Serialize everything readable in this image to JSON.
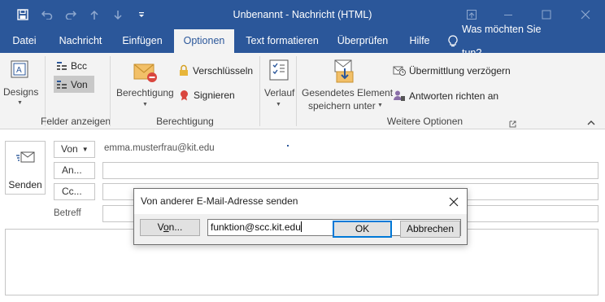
{
  "title_bar": {
    "title": "Unbenannt  -  Nachricht (HTML)",
    "qat_icons": [
      "save-icon",
      "undo-icon",
      "redo-icon",
      "up-arrow-icon",
      "down-arrow-icon",
      "customize-qat-icon"
    ],
    "window_icons": [
      "ribbon-display-options-icon",
      "minimize-icon",
      "maximize-icon",
      "close-icon"
    ]
  },
  "tabs": [
    {
      "label": "Datei"
    },
    {
      "label": "Nachricht"
    },
    {
      "label": "Einfügen"
    },
    {
      "label": "Optionen",
      "active": true
    },
    {
      "label": "Text formatieren"
    },
    {
      "label": "Überprüfen"
    },
    {
      "label": "Hilfe"
    }
  ],
  "tell_me": {
    "label": "Was möchten Sie tun?",
    "icon": "lightbulb-icon"
  },
  "ribbon": {
    "designs": {
      "label": "Designs",
      "icon": "designs-icon"
    },
    "bcc": {
      "label": "Bcc",
      "icon": "bcc-icon"
    },
    "von": {
      "label": "Von",
      "icon": "from-icon",
      "selected": true
    },
    "group_felder": "Felder anzeigen",
    "berechtigung": {
      "label": "Berechtigung",
      "icon": "permission-icon"
    },
    "verschluesseln": {
      "label": "Verschlüsseln",
      "icon": "lock-icon"
    },
    "signieren": {
      "label": "Signieren",
      "icon": "signature-icon"
    },
    "group_berechtigung": "Berechtigung",
    "verlauf": {
      "label": "Verlauf",
      "icon": "tracking-icon"
    },
    "gesendetes": {
      "line1": "Gesendetes Element",
      "line2": "speichern unter",
      "icon": "save-sent-item-icon"
    },
    "verzoegern": {
      "label": "Übermittlung verzögern",
      "icon": "delay-delivery-icon"
    },
    "antworten": {
      "label": "Antworten richten an",
      "icon": "direct-replies-icon"
    },
    "group_weitere": "Weitere Optionen",
    "colors": {
      "accent": "#2b579a",
      "ribbon_bg": "#f3f3f3",
      "selected_bg": "#c8c8c8"
    }
  },
  "compose": {
    "send_label": "Senden",
    "from_button": "Von",
    "from_address": "emma.musterfrau@kit.edu",
    "to_button": "An...",
    "cc_button": "Cc...",
    "subject_label": "Betreff"
  },
  "dialog": {
    "title": "Von anderer E-Mail-Adresse senden",
    "von_button_prefix": "V",
    "von_button_underlined": "o",
    "von_button_suffix": "n...",
    "input_value": "funktion@scc.kit.edu",
    "ok_label": "OK",
    "cancel_label": "Abbrechen"
  }
}
